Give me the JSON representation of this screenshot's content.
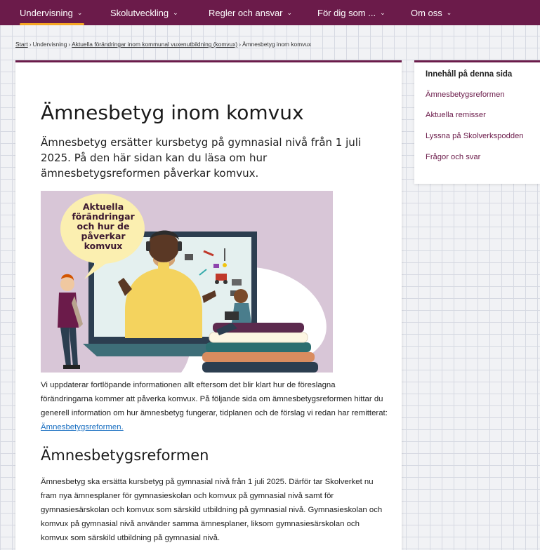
{
  "nav": {
    "items": [
      {
        "label": "Undervisning",
        "active": true
      },
      {
        "label": "Skolutveckling"
      },
      {
        "label": "Regler och ansvar"
      },
      {
        "label": "För dig som ..."
      },
      {
        "label": "Om oss"
      }
    ],
    "accent_underline_color": "#f5a623",
    "background_color": "#6b1b4a"
  },
  "breadcrumb": {
    "items": [
      "Start",
      "Undervisning",
      "Aktuella förändringar inom kommunal vuxenutbildning (komvux)",
      "Ämnesbetyg inom komvux"
    ],
    "separator": "›"
  },
  "main": {
    "title": "Ämnesbetyg inom komvux",
    "intro": "Ämnesbetyg ersätter kursbetyg på gymnasial nivå från 1 juli 2025. På den här sidan kan du läsa om hur ämnesbetygsreformen påverkar komvux.",
    "hero": {
      "bubble_text": "Aktuella förändringar och hur de påverkar komvux"
    },
    "paragraph1": "Vi uppdaterar fortlöpande informationen allt eftersom det blir klart hur de föreslagna förändringarna kommer att påverka komvux. På följande sida om ämnesbetygsreformen hittar du generell information om hur ämnesbetyg fungerar, tidplanen och de förslag vi redan har remitterat: ",
    "paragraph1_link": "Ämnesbetygsreformen.",
    "section_title": "Ämnesbetygsreformen",
    "paragraph2": "Ämnesbetyg ska ersätta kursbetyg på gymnasial nivå från 1 juli 2025. Därför tar Skolverket nu fram nya ämnesplaner för gymnasieskolan och komvux på gymnasial nivå samt för gymnasiesärskolan och komvux som särskild utbildning på gymnasial nivå. Gymnasieskolan och komvux på gymnasial nivå använder samma ämnesplaner, liksom gymnasiesärskolan och komvux som särskild utbildning på gymnasial nivå."
  },
  "toc": {
    "heading": "Innehåll på denna sida",
    "links": [
      "Ämnesbetygsreformen",
      "Aktuella remisser",
      "Lyssna på Skolverkspodden",
      "Frågor och svar"
    ]
  }
}
